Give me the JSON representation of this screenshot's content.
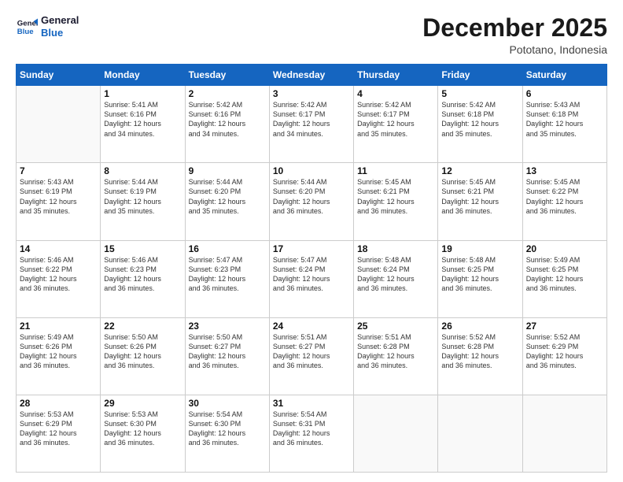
{
  "logo": {
    "line1": "General",
    "line2": "Blue"
  },
  "title": "December 2025",
  "subtitle": "Pototano, Indonesia",
  "days_header": [
    "Sunday",
    "Monday",
    "Tuesday",
    "Wednesday",
    "Thursday",
    "Friday",
    "Saturday"
  ],
  "weeks": [
    [
      {
        "num": "",
        "info": ""
      },
      {
        "num": "1",
        "info": "Sunrise: 5:41 AM\nSunset: 6:16 PM\nDaylight: 12 hours\nand 34 minutes."
      },
      {
        "num": "2",
        "info": "Sunrise: 5:42 AM\nSunset: 6:16 PM\nDaylight: 12 hours\nand 34 minutes."
      },
      {
        "num": "3",
        "info": "Sunrise: 5:42 AM\nSunset: 6:17 PM\nDaylight: 12 hours\nand 34 minutes."
      },
      {
        "num": "4",
        "info": "Sunrise: 5:42 AM\nSunset: 6:17 PM\nDaylight: 12 hours\nand 35 minutes."
      },
      {
        "num": "5",
        "info": "Sunrise: 5:42 AM\nSunset: 6:18 PM\nDaylight: 12 hours\nand 35 minutes."
      },
      {
        "num": "6",
        "info": "Sunrise: 5:43 AM\nSunset: 6:18 PM\nDaylight: 12 hours\nand 35 minutes."
      }
    ],
    [
      {
        "num": "7",
        "info": "Sunrise: 5:43 AM\nSunset: 6:19 PM\nDaylight: 12 hours\nand 35 minutes."
      },
      {
        "num": "8",
        "info": "Sunrise: 5:44 AM\nSunset: 6:19 PM\nDaylight: 12 hours\nand 35 minutes."
      },
      {
        "num": "9",
        "info": "Sunrise: 5:44 AM\nSunset: 6:20 PM\nDaylight: 12 hours\nand 35 minutes."
      },
      {
        "num": "10",
        "info": "Sunrise: 5:44 AM\nSunset: 6:20 PM\nDaylight: 12 hours\nand 36 minutes."
      },
      {
        "num": "11",
        "info": "Sunrise: 5:45 AM\nSunset: 6:21 PM\nDaylight: 12 hours\nand 36 minutes."
      },
      {
        "num": "12",
        "info": "Sunrise: 5:45 AM\nSunset: 6:21 PM\nDaylight: 12 hours\nand 36 minutes."
      },
      {
        "num": "13",
        "info": "Sunrise: 5:45 AM\nSunset: 6:22 PM\nDaylight: 12 hours\nand 36 minutes."
      }
    ],
    [
      {
        "num": "14",
        "info": "Sunrise: 5:46 AM\nSunset: 6:22 PM\nDaylight: 12 hours\nand 36 minutes."
      },
      {
        "num": "15",
        "info": "Sunrise: 5:46 AM\nSunset: 6:23 PM\nDaylight: 12 hours\nand 36 minutes."
      },
      {
        "num": "16",
        "info": "Sunrise: 5:47 AM\nSunset: 6:23 PM\nDaylight: 12 hours\nand 36 minutes."
      },
      {
        "num": "17",
        "info": "Sunrise: 5:47 AM\nSunset: 6:24 PM\nDaylight: 12 hours\nand 36 minutes."
      },
      {
        "num": "18",
        "info": "Sunrise: 5:48 AM\nSunset: 6:24 PM\nDaylight: 12 hours\nand 36 minutes."
      },
      {
        "num": "19",
        "info": "Sunrise: 5:48 AM\nSunset: 6:25 PM\nDaylight: 12 hours\nand 36 minutes."
      },
      {
        "num": "20",
        "info": "Sunrise: 5:49 AM\nSunset: 6:25 PM\nDaylight: 12 hours\nand 36 minutes."
      }
    ],
    [
      {
        "num": "21",
        "info": "Sunrise: 5:49 AM\nSunset: 6:26 PM\nDaylight: 12 hours\nand 36 minutes."
      },
      {
        "num": "22",
        "info": "Sunrise: 5:50 AM\nSunset: 6:26 PM\nDaylight: 12 hours\nand 36 minutes."
      },
      {
        "num": "23",
        "info": "Sunrise: 5:50 AM\nSunset: 6:27 PM\nDaylight: 12 hours\nand 36 minutes."
      },
      {
        "num": "24",
        "info": "Sunrise: 5:51 AM\nSunset: 6:27 PM\nDaylight: 12 hours\nand 36 minutes."
      },
      {
        "num": "25",
        "info": "Sunrise: 5:51 AM\nSunset: 6:28 PM\nDaylight: 12 hours\nand 36 minutes."
      },
      {
        "num": "26",
        "info": "Sunrise: 5:52 AM\nSunset: 6:28 PM\nDaylight: 12 hours\nand 36 minutes."
      },
      {
        "num": "27",
        "info": "Sunrise: 5:52 AM\nSunset: 6:29 PM\nDaylight: 12 hours\nand 36 minutes."
      }
    ],
    [
      {
        "num": "28",
        "info": "Sunrise: 5:53 AM\nSunset: 6:29 PM\nDaylight: 12 hours\nand 36 minutes."
      },
      {
        "num": "29",
        "info": "Sunrise: 5:53 AM\nSunset: 6:30 PM\nDaylight: 12 hours\nand 36 minutes."
      },
      {
        "num": "30",
        "info": "Sunrise: 5:54 AM\nSunset: 6:30 PM\nDaylight: 12 hours\nand 36 minutes."
      },
      {
        "num": "31",
        "info": "Sunrise: 5:54 AM\nSunset: 6:31 PM\nDaylight: 12 hours\nand 36 minutes."
      },
      {
        "num": "",
        "info": ""
      },
      {
        "num": "",
        "info": ""
      },
      {
        "num": "",
        "info": ""
      }
    ]
  ]
}
